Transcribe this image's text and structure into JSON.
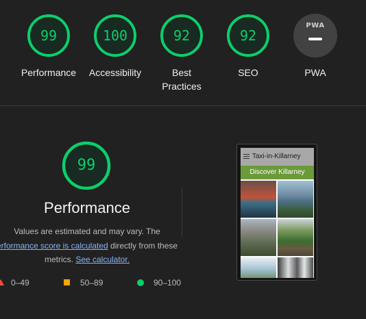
{
  "categories": [
    {
      "label": "Performance",
      "score": "99"
    },
    {
      "label": "Accessibility",
      "score": "100"
    },
    {
      "label": "Best Practices",
      "label_line1": "Best",
      "label_line2": "Practices",
      "score": "92"
    },
    {
      "label": "SEO",
      "score": "92"
    },
    {
      "label": "PWA",
      "badge_text": "PWA"
    }
  ],
  "main": {
    "score": "99",
    "title": "Performance",
    "desc_line1": "Values are estimated and may vary. The",
    "link_text": "erformance score is calculated",
    "desc_line2_rest": " directly from these",
    "desc_line3_text": "metrics. ",
    "calculator_link": "See calculator."
  },
  "legend": [
    {
      "range": "0–49",
      "color": "#ff4e42",
      "shape": "triangle"
    },
    {
      "range": "50–89",
      "color": "#ffa400",
      "shape": "square"
    },
    {
      "range": "90–100",
      "color": "#0cce6b",
      "shape": "circle"
    }
  ],
  "screenshot": {
    "site_title": "Taxi-in-Killarney",
    "banner": "Discover Killarney"
  },
  "colors": {
    "pass": "#0cce6b",
    "background": "#212121",
    "link": "#8ab4f8"
  }
}
